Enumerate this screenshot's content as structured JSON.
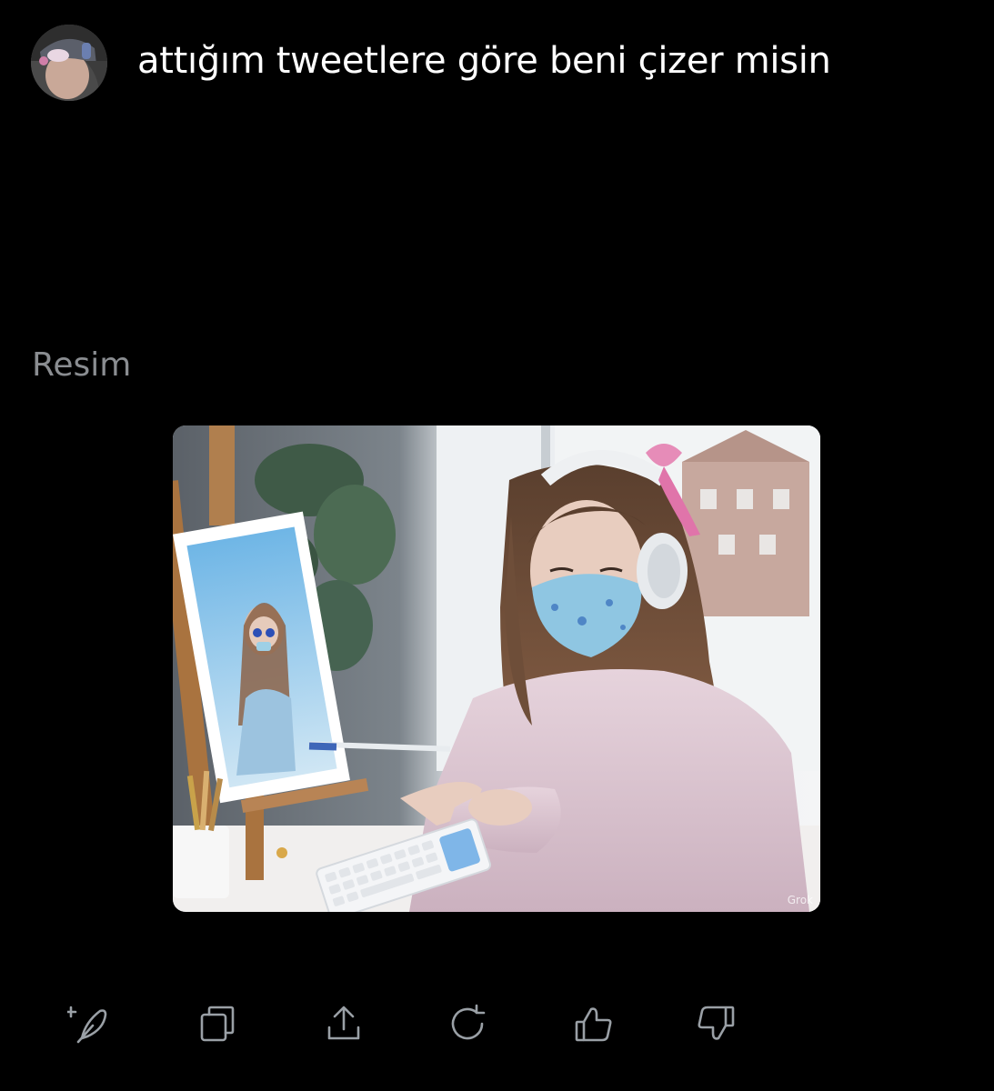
{
  "message": {
    "text": "attığım tweetlere göre beni çizer misin"
  },
  "response": {
    "section_label": "Resim",
    "watermark": "Grok"
  },
  "actions": [
    {
      "name": "regenerate-new-icon",
      "icon": "feather-plus-icon"
    },
    {
      "name": "copy-icon",
      "icon": "copy-icon"
    },
    {
      "name": "share-icon",
      "icon": "upload-icon"
    },
    {
      "name": "refresh-icon",
      "icon": "refresh-icon"
    },
    {
      "name": "thumbs-up-icon",
      "icon": "thumbs-up-icon"
    },
    {
      "name": "thumbs-down-icon",
      "icon": "thumbs-down-icon"
    }
  ],
  "colors": {
    "background": "#000000",
    "text": "#ffffff",
    "muted": "#8a8d91",
    "icon": "#9aa0a6"
  }
}
